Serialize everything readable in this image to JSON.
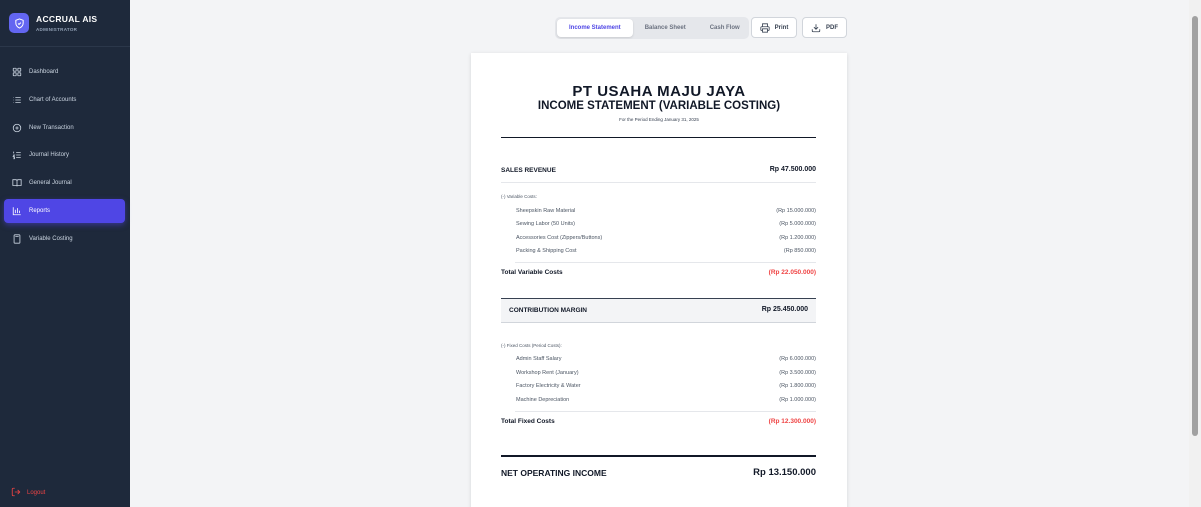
{
  "brand": {
    "name": "ACCRUAL AIS",
    "role": "ADMINISTRATOR"
  },
  "nav": [
    {
      "label": "Dashboard",
      "icon": "dashboard-icon"
    },
    {
      "label": "Chart of Accounts",
      "icon": "list-icon"
    },
    {
      "label": "New Transaction",
      "icon": "plus-circle-icon"
    },
    {
      "label": "Journal History",
      "icon": "list-ordered-icon"
    },
    {
      "label": "General Journal",
      "icon": "book-icon"
    },
    {
      "label": "Reports",
      "icon": "bar-chart-icon",
      "active": true
    },
    {
      "label": "Variable Costing",
      "icon": "calculator-icon"
    }
  ],
  "logout": "Logout",
  "tabs": [
    "Income Statement",
    "Balance Sheet",
    "Cash Flow"
  ],
  "toolbar": {
    "print": "Print",
    "pdf": "PDF"
  },
  "report": {
    "company": "PT USAHA MAJU JAYA",
    "title": "INCOME STATEMENT (VARIABLE COSTING)",
    "period": "For the Period Ending January 31, 2025",
    "sales": {
      "label": "SALES REVENUE",
      "value": "Rp 47.500.000"
    },
    "variable": {
      "heading": "(-) Variable Costs:",
      "items": [
        {
          "label": "Sheepskin Raw Material",
          "value": "(Rp 15.000.000)"
        },
        {
          "label": "Sewing Labor (50 Units)",
          "value": "(Rp 5.000.000)"
        },
        {
          "label": "Accessories Cost (Zippers/Buttons)",
          "value": "(Rp 1.200.000)"
        },
        {
          "label": "Packing & Shipping Cost",
          "value": "(Rp 850.000)"
        }
      ],
      "total_label": "Total Variable Costs",
      "total_value": "(Rp 22.050.000)"
    },
    "contribution": {
      "label": "CONTRIBUTION MARGIN",
      "value": "Rp 25.450.000"
    },
    "fixed": {
      "heading": "(-) Fixed Costs (Period Costs):",
      "items": [
        {
          "label": "Admin Staff Salary",
          "value": "(Rp 6.000.000)"
        },
        {
          "label": "Workshop Rent (January)",
          "value": "(Rp 3.500.000)"
        },
        {
          "label": "Factory Electricity & Water",
          "value": "(Rp 1.800.000)"
        },
        {
          "label": "Machine Depreciation",
          "value": "(Rp 1.000.000)"
        }
      ],
      "total_label": "Total Fixed Costs",
      "total_value": "(Rp 12.300.000)"
    },
    "net": {
      "label": "NET OPERATING INCOME",
      "value": "Rp 13.150.000"
    }
  },
  "colors": {
    "sidebar": "#1e293b",
    "accent": "#4f46e5",
    "negative": "#ef4444"
  }
}
